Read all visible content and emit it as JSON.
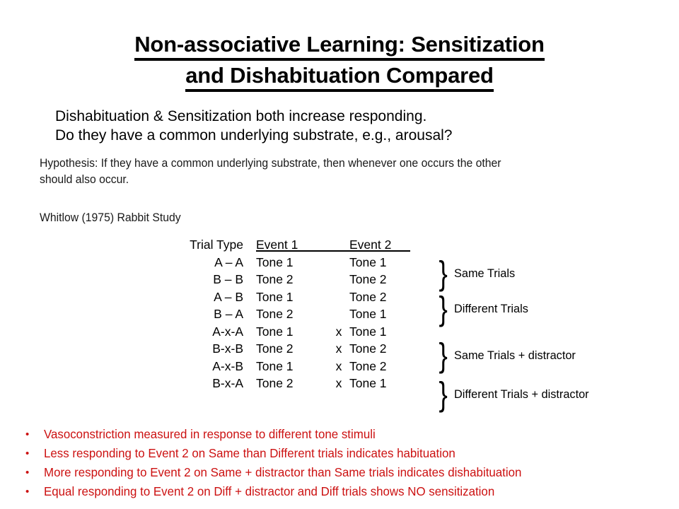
{
  "slide": {
    "title_lines": [
      "Non-associative Learning: Sensitization",
      "and Dishabituation Compared"
    ],
    "intro_lines": [
      "Dishabituation & Sensitization both increase responding.",
      "Do they have a common underlying substrate, e.g., arousal?"
    ],
    "hypothesis_lines": [
      "Hypothesis:  If they have a common underlying substrate, then whenever one occurs the other",
      "should also occur."
    ],
    "study_line": "Whitlow (1975) Rabbit Study"
  },
  "table": {
    "headers": {
      "trial_type": "Trial Type",
      "event1": "Event 1",
      "event2": "Event 2"
    },
    "rows": [
      {
        "trial_type": "A – A",
        "event1": "Tone 1",
        "x": "",
        "event2": "Tone 1"
      },
      {
        "trial_type": "B – B",
        "event1": "Tone 2",
        "x": "",
        "event2": "Tone 2"
      },
      {
        "trial_type": "A – B",
        "event1": "Tone 1",
        "x": "",
        "event2": "Tone 2"
      },
      {
        "trial_type": "B – A",
        "event1": "Tone 2",
        "x": "",
        "event2": "Tone 1"
      },
      {
        "trial_type": "A-x-A",
        "event1": "Tone 1",
        "x": "x",
        "event2": "Tone 1"
      },
      {
        "trial_type": "B-x-B",
        "event1": "Tone 2",
        "x": "x",
        "event2": "Tone 2"
      },
      {
        "trial_type": "A-x-B",
        "event1": "Tone 1",
        "x": "x",
        "event2": "Tone 2"
      },
      {
        "trial_type": "B-x-A",
        "event1": "Tone 2",
        "x": "x",
        "event2": "Tone 1"
      }
    ]
  },
  "braces": {
    "glyph": "}",
    "groups": [
      {
        "label": "Same Trials"
      },
      {
        "label": "Different Trials"
      },
      {
        "label": "Same Trials + distractor"
      },
      {
        "label": "Different Trials + distractor"
      }
    ]
  },
  "bullets": {
    "marker": "•",
    "items": [
      "Vasoconstriction measured in response to different tone stimuli",
      "Less responding to Event 2 on Same than Different trials indicates habituation",
      "More responding to Event 2 on Same + distractor than Same trials indicates dishabituation",
      "Equal responding to Event 2 on Diff + distractor and Diff trials shows NO sensitization"
    ]
  },
  "colors": {
    "text": "#000000",
    "bullet_red": "#CC1111",
    "background": "#FFFFFF"
  }
}
